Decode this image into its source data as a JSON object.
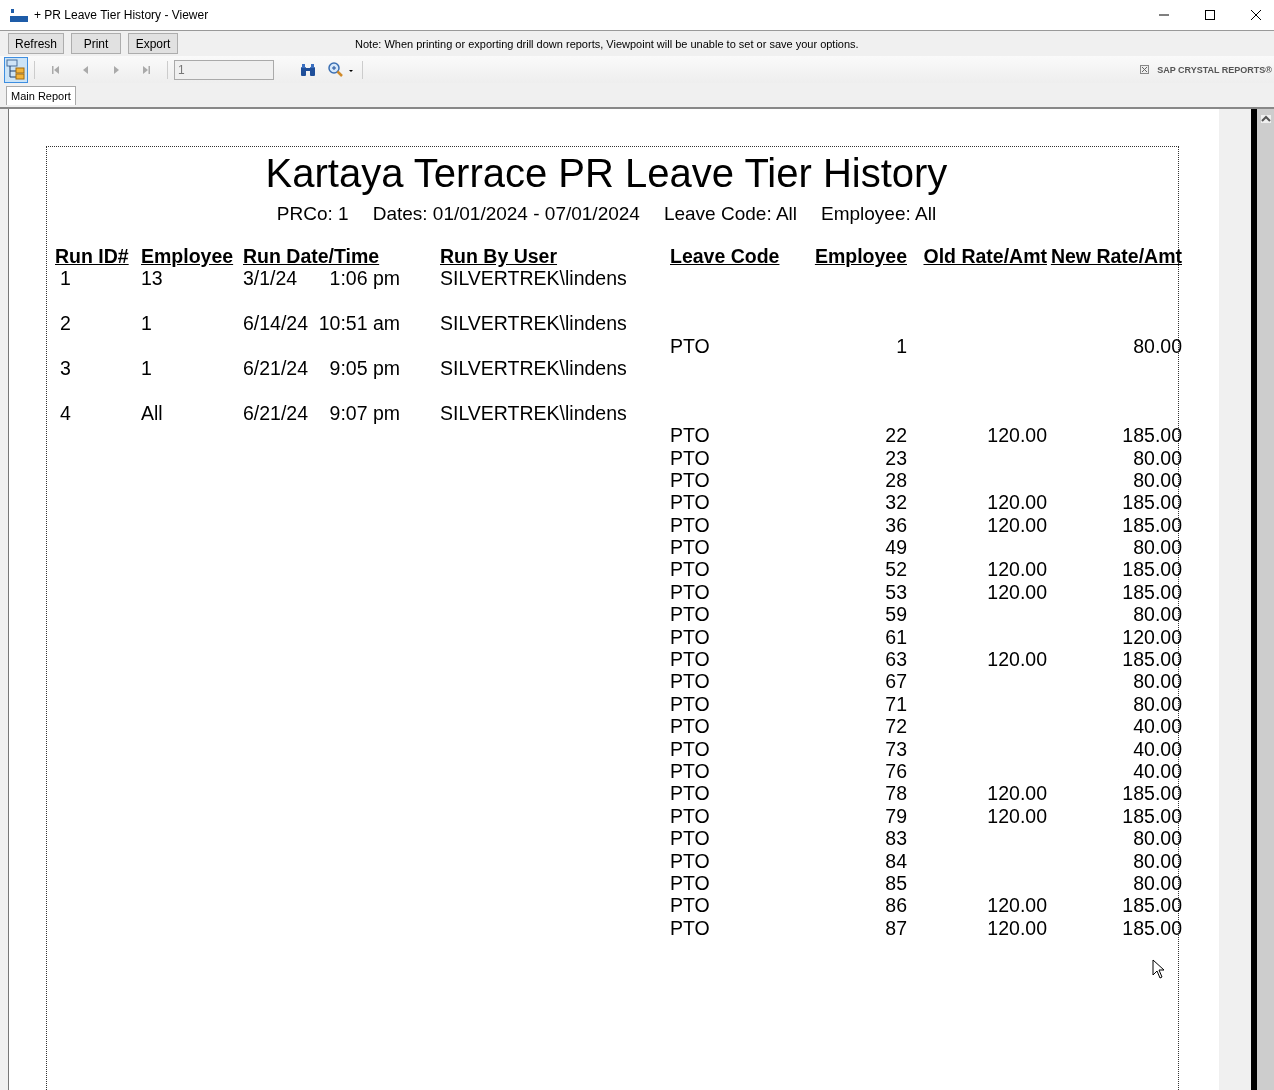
{
  "window": {
    "title": "+ PR Leave Tier History - Viewer"
  },
  "buttons": [
    "Refresh",
    "Print",
    "Export"
  ],
  "note": "Note: When printing or exporting drill down reports, Viewpoint will be unable to set or save your options.",
  "toolbar": {
    "group_tree_toggle_selected": true,
    "page_field": "1",
    "brand": "SAP CRYSTAL REPORTS®"
  },
  "tabs": [
    {
      "label": "Main Report",
      "selected": true
    }
  ],
  "report": {
    "title": "Kartaya Terrace PR Leave Tier History",
    "parameters": [
      "PRCo: 1",
      "Dates: 01/01/2024 - 07/01/2024",
      "Leave Code: All",
      "Employee: All"
    ],
    "columns": [
      "Run ID#",
      "Employee",
      "Run Date/Time",
      "Run By User",
      "Leave Code",
      "Employee",
      "Old Rate/Amt",
      "New Rate/Amt"
    ],
    "runs": [
      {
        "run_id": "1",
        "employee": "13",
        "date": "3/1/24",
        "time": "1:06 pm",
        "user": "SILVERTREK\\lindens"
      },
      {
        "run_id": "2",
        "employee": "1",
        "date": "6/14/24",
        "time": "10:51 am",
        "user": "SILVERTREK\\lindens",
        "details": [
          {
            "leave_code": "PTO",
            "employee": "1",
            "new_rate": "80.00"
          }
        ]
      },
      {
        "run_id": "3",
        "employee": "1",
        "date": "6/21/24",
        "time": "9:05 pm",
        "user": "SILVERTREK\\lindens"
      },
      {
        "run_id": "4",
        "employee": "All",
        "date": "6/21/24",
        "time": "9:07 pm",
        "user": "SILVERTREK\\lindens",
        "details": [
          {
            "leave_code": "PTO",
            "employee": "22",
            "old_rate": "120.00",
            "new_rate": "185.00"
          },
          {
            "leave_code": "PTO",
            "employee": "23",
            "new_rate": "80.00"
          },
          {
            "leave_code": "PTO",
            "employee": "28",
            "new_rate": "80.00"
          },
          {
            "leave_code": "PTO",
            "employee": "32",
            "old_rate": "120.00",
            "new_rate": "185.00"
          },
          {
            "leave_code": "PTO",
            "employee": "36",
            "old_rate": "120.00",
            "new_rate": "185.00"
          },
          {
            "leave_code": "PTO",
            "employee": "49",
            "new_rate": "80.00"
          },
          {
            "leave_code": "PTO",
            "employee": "52",
            "old_rate": "120.00",
            "new_rate": "185.00"
          },
          {
            "leave_code": "PTO",
            "employee": "53",
            "old_rate": "120.00",
            "new_rate": "185.00"
          },
          {
            "leave_code": "PTO",
            "employee": "59",
            "new_rate": "80.00"
          },
          {
            "leave_code": "PTO",
            "employee": "61",
            "new_rate": "120.00"
          },
          {
            "leave_code": "PTO",
            "employee": "63",
            "old_rate": "120.00",
            "new_rate": "185.00"
          },
          {
            "leave_code": "PTO",
            "employee": "67",
            "new_rate": "80.00"
          },
          {
            "leave_code": "PTO",
            "employee": "71",
            "new_rate": "80.00"
          },
          {
            "leave_code": "PTO",
            "employee": "72",
            "new_rate": "40.00"
          },
          {
            "leave_code": "PTO",
            "employee": "73",
            "new_rate": "40.00"
          },
          {
            "leave_code": "PTO",
            "employee": "76",
            "new_rate": "40.00"
          },
          {
            "leave_code": "PTO",
            "employee": "78",
            "old_rate": "120.00",
            "new_rate": "185.00"
          },
          {
            "leave_code": "PTO",
            "employee": "79",
            "old_rate": "120.00",
            "new_rate": "185.00"
          },
          {
            "leave_code": "PTO",
            "employee": "83",
            "new_rate": "80.00"
          },
          {
            "leave_code": "PTO",
            "employee": "84",
            "new_rate": "80.00"
          },
          {
            "leave_code": "PTO",
            "employee": "85",
            "new_rate": "80.00"
          },
          {
            "leave_code": "PTO",
            "employee": "86",
            "old_rate": "120.00",
            "new_rate": "185.00"
          },
          {
            "leave_code": "PTO",
            "employee": "87",
            "old_rate": "120.00",
            "new_rate": "185.00"
          }
        ]
      }
    ]
  }
}
